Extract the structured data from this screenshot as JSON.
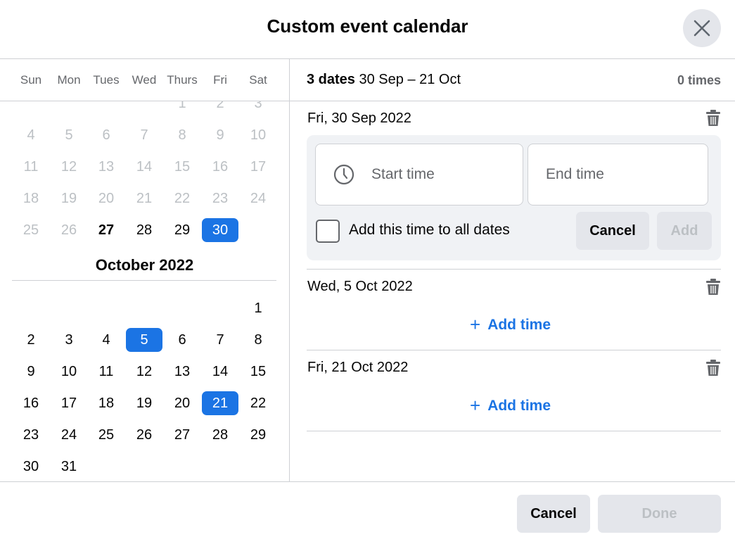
{
  "dialog": {
    "title": "Custom event calendar",
    "close_icon": "close-icon"
  },
  "weekdays": [
    "Sun",
    "Mon",
    "Tues",
    "Wed",
    "Thurs",
    "Fri",
    "Sat"
  ],
  "september": {
    "first_weekday": 4,
    "days": 30,
    "muted_through": 26,
    "bold": [
      27
    ],
    "selected": [
      30
    ]
  },
  "october": {
    "title": "October 2022",
    "first_weekday": 6,
    "days": 31,
    "selected": [
      5,
      21
    ]
  },
  "summary": {
    "count": "3 dates",
    "range": "30 Sep – 21 Oct",
    "times": "0 times"
  },
  "dates": [
    {
      "label": "Fri, 30 Sep 2022",
      "editing": true
    },
    {
      "label": "Wed, 5 Oct 2022",
      "add_time": "Add time"
    },
    {
      "label": "Fri, 21 Oct 2022",
      "add_time": "Add time"
    }
  ],
  "editor": {
    "start_placeholder": "Start time",
    "end_placeholder": "End time",
    "checkbox_label": "Add this time to all dates",
    "checked": false,
    "cancel": "Cancel",
    "add": "Add"
  },
  "footer": {
    "cancel": "Cancel",
    "done": "Done"
  },
  "colors": {
    "accent": "#1b74e4",
    "muted": "#bcc0c4",
    "button_bg": "#e4e6eb"
  }
}
